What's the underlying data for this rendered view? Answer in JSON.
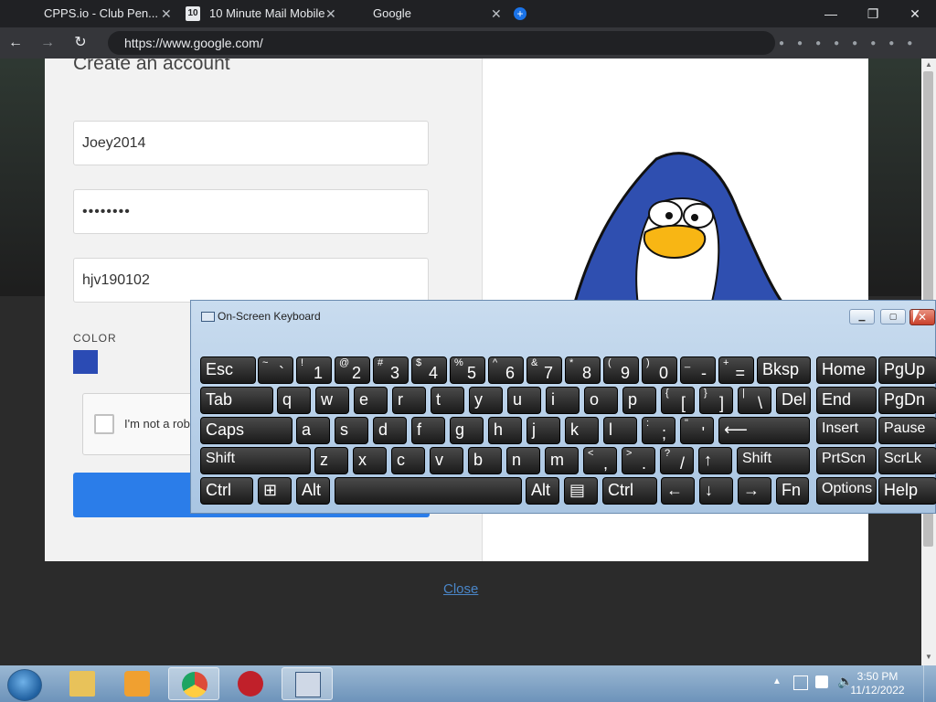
{
  "tabs": [
    {
      "title": "CPPS.io - Club Pen...",
      "fav": "",
      "fav_color": "#202124"
    },
    {
      "title": "10 Minute Mail Mobile",
      "fav": "10",
      "fav_color": "#e8eaed"
    },
    {
      "title": "Google",
      "fav": "",
      "fav_color": "#202124"
    }
  ],
  "tab_close_glyph": "✕",
  "new_tab_glyph": "+",
  "window_controls": {
    "minimize": "—",
    "restore": "❐",
    "close": "✕"
  },
  "address": {
    "url": "https://www.google.com/"
  },
  "nav": {
    "back": "←",
    "forward": "→",
    "reload": "↻"
  },
  "form": {
    "title": "Create an account",
    "username": "Joey2014",
    "password": "••••••••",
    "email": "hjv190102",
    "color_label": "COLOR",
    "color_value": "#2b4bb4",
    "captcha_label": "I'm not a robot"
  },
  "close_link": "Close",
  "osk": {
    "title": "On-Screen Keyboard",
    "rows": [
      [
        {
          "m": "Esc"
        },
        {
          "s": "~",
          "l": "`"
        },
        {
          "s": "!",
          "l": "1"
        },
        {
          "s": "@",
          "l": "2"
        },
        {
          "s": "#",
          "l": "3"
        },
        {
          "s": "$",
          "l": "4"
        },
        {
          "s": "%",
          "l": "5"
        },
        {
          "s": "^",
          "l": "6"
        },
        {
          "s": "&",
          "l": "7"
        },
        {
          "s": "*",
          "l": "8"
        },
        {
          "s": "(",
          "l": "9"
        },
        {
          "s": ")",
          "l": "0"
        },
        {
          "s": "_",
          "l": "-"
        },
        {
          "s": "+",
          "l": "="
        },
        {
          "m": "Bksp"
        },
        {
          "m": "Home"
        },
        {
          "m": "PgUp"
        }
      ],
      [
        {
          "m": "Tab"
        },
        {
          "m": "q"
        },
        {
          "m": "w"
        },
        {
          "m": "e"
        },
        {
          "m": "r"
        },
        {
          "m": "t"
        },
        {
          "m": "y"
        },
        {
          "m": "u"
        },
        {
          "m": "i"
        },
        {
          "m": "o"
        },
        {
          "m": "p"
        },
        {
          "s": "{",
          "l": "["
        },
        {
          "s": "}",
          "l": "]"
        },
        {
          "s": "|",
          "l": "\\"
        },
        {
          "m": "Del"
        },
        {
          "m": "End"
        },
        {
          "m": "PgDn"
        }
      ],
      [
        {
          "m": "Caps"
        },
        {
          "m": "a"
        },
        {
          "m": "s"
        },
        {
          "m": "d"
        },
        {
          "m": "f"
        },
        {
          "m": "g"
        },
        {
          "m": "h"
        },
        {
          "m": "j"
        },
        {
          "m": "k"
        },
        {
          "m": "l"
        },
        {
          "s": ":",
          "l": ";"
        },
        {
          "s": "\"",
          "l": "'"
        },
        {
          "m": "⟵"
        },
        {
          "m": "Insert"
        },
        {
          "m": "Pause"
        }
      ],
      [
        {
          "m": "Shift"
        },
        {
          "m": "z"
        },
        {
          "m": "x"
        },
        {
          "m": "c"
        },
        {
          "m": "v"
        },
        {
          "m": "b"
        },
        {
          "m": "n"
        },
        {
          "m": "m"
        },
        {
          "s": "<",
          "l": ","
        },
        {
          "s": ">",
          "l": "."
        },
        {
          "s": "?",
          "l": "/"
        },
        {
          "m": "↑"
        },
        {
          "m": "Shift"
        },
        {
          "m": "PrtScn"
        },
        {
          "m": "ScrLk"
        }
      ],
      [
        {
          "m": "Ctrl"
        },
        {
          "m": "⊞"
        },
        {
          "m": "Alt"
        },
        {
          "m": ""
        },
        {
          "m": "Alt"
        },
        {
          "m": "▤"
        },
        {
          "m": "Ctrl"
        },
        {
          "m": "←"
        },
        {
          "m": "↓"
        },
        {
          "m": "→"
        },
        {
          "m": "Fn"
        },
        {
          "m": "Options"
        },
        {
          "m": "Help"
        }
      ]
    ]
  },
  "taskbar": {
    "items": [
      {
        "icon": "file-explorer-icon",
        "color": "#e8c25a"
      },
      {
        "icon": "media-player-icon",
        "color": "#f0a030"
      },
      {
        "icon": "chrome-icon",
        "color": "#dd4b39"
      },
      {
        "icon": "club-penguin-icon",
        "color": "#c0202a"
      },
      {
        "icon": "on-screen-keyboard-icon",
        "color": "#cfd8e6"
      }
    ],
    "clock_time": "3:50 PM",
    "clock_date": "11/12/2022"
  }
}
